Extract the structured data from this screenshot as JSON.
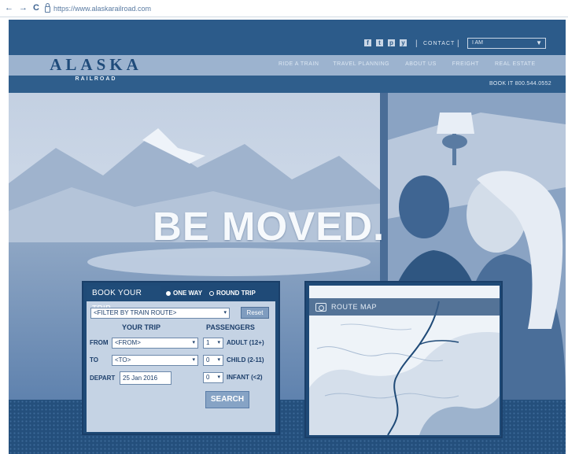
{
  "browser": {
    "back": "←",
    "forward": "→",
    "reload": "C",
    "url": "https://www.alaskarailroad.com"
  },
  "utility": {
    "social_icons": [
      "facebook-icon",
      "twitter-icon",
      "pinterest-icon",
      "youtube-icon"
    ],
    "contact": "CONTACT",
    "iam": "I AM",
    "separator": "|"
  },
  "logo": {
    "main": "ALASKA",
    "sub": "RAILROAD"
  },
  "nav": {
    "items": [
      "RIDE A TRAIN",
      "TRAVEL PLANNING",
      "ABOUT US",
      "FREIGHT",
      "REAL ESTATE"
    ]
  },
  "booking_phone": "BOOK IT  800.544.0552",
  "hero": {
    "headline": "BE MOVED."
  },
  "widget": {
    "tab": "BOOK YOUR TRIP",
    "one_way": "ONE WAY",
    "round_trip": "ROUND TRIP",
    "filter": "<FILTER BY TRAIN ROUTE>",
    "reset": "Reset",
    "your_trip": "YOUR TRIP",
    "passengers": "PASSENGERS",
    "from_label": "FROM",
    "from_value": "<FROM>",
    "to_label": "TO",
    "to_value": "<TO>",
    "depart_label": "DEPART",
    "depart_value": "25 Jan 2016",
    "adult_count": "1",
    "adult_label": "ADULT (12+)",
    "child_count": "0",
    "child_label": "CHILD (2-11)",
    "infant_count": "0",
    "infant_label": "INFANT (<2)",
    "search": "SEARCH"
  },
  "map": {
    "label": "ROUTE MAP"
  },
  "colors": {
    "primary": "#204c79",
    "band": "#9cb3cf",
    "accent": "#86a3c5"
  }
}
